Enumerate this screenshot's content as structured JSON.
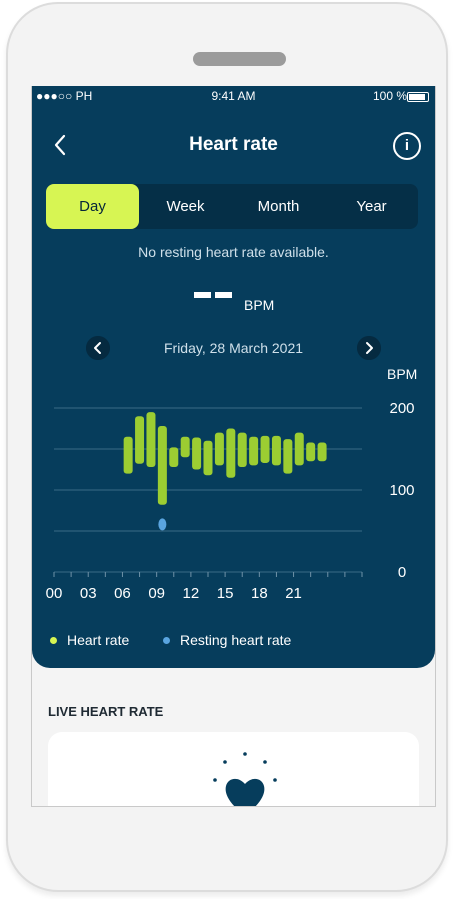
{
  "status": {
    "carrier": "●●●○○ PH",
    "time": "9:41 AM",
    "battery": "100 %",
    "battery_level": 1.0
  },
  "nav": {
    "title": "Heart rate",
    "info": "i"
  },
  "tabs": [
    {
      "label": "Day",
      "active": true
    },
    {
      "label": "Week",
      "active": false
    },
    {
      "label": "Month",
      "active": false
    },
    {
      "label": "Year",
      "active": false
    }
  ],
  "summary": {
    "note": "No resting heart rate available.",
    "unit": "BPM"
  },
  "date": {
    "label": "Friday, 28 March 2021"
  },
  "chart_data": {
    "type": "bar",
    "ylabel": "BPM",
    "ylim": [
      0,
      200
    ],
    "yticks": [
      "0",
      "100",
      "200"
    ],
    "x_tick_labels": [
      "00",
      "03",
      "06",
      "09",
      "12",
      "15",
      "18",
      "21"
    ],
    "grid": true,
    "series": [
      {
        "name": "Heart rate",
        "color": "#9ccd32",
        "ranges": [
          [
            6.5,
            120,
            165
          ],
          [
            7.5,
            132,
            190
          ],
          [
            8.5,
            128,
            195
          ],
          [
            9.5,
            82,
            178
          ],
          [
            10.5,
            128,
            152
          ],
          [
            11.5,
            140,
            165
          ],
          [
            12.5,
            125,
            164
          ],
          [
            13.5,
            118,
            160
          ],
          [
            14.5,
            130,
            170
          ],
          [
            15.5,
            115,
            175
          ],
          [
            16.5,
            128,
            170
          ],
          [
            17.5,
            130,
            165
          ],
          [
            18.5,
            133,
            166
          ],
          [
            19.5,
            130,
            166
          ],
          [
            20.5,
            120,
            162
          ],
          [
            21.5,
            130,
            170
          ],
          [
            22.5,
            135,
            158
          ],
          [
            23.5,
            135,
            158
          ]
        ]
      },
      {
        "name": "Resting heart rate",
        "color": "#5aa5e0",
        "points": [
          [
            9.5,
            63
          ]
        ]
      }
    ]
  },
  "legend": {
    "heart_rate": "Heart rate",
    "resting_heart_rate": "Resting heart rate"
  },
  "live": {
    "title": "LIVE HEART RATE"
  },
  "colors": {
    "panel": "#063d5c",
    "accent": "#d7f553",
    "heart": "#9ccd32",
    "resting": "#5aa5e0"
  }
}
